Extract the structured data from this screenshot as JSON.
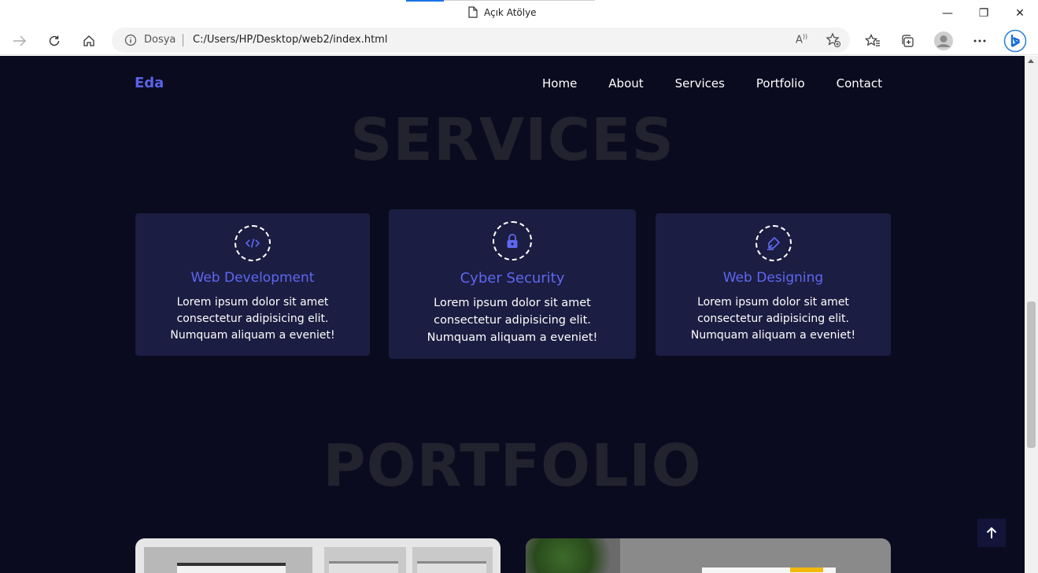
{
  "window": {
    "title": "Açık Atölye"
  },
  "addressbar": {
    "security_label": "Dosya",
    "url": "C:/Users/HP/Desktop/web2/index.html"
  },
  "site": {
    "logo": "Eda",
    "nav": [
      "Home",
      "About",
      "Services",
      "Portfolio",
      "Contact"
    ],
    "services_heading": "SERVICES",
    "services": [
      {
        "icon": "code-icon",
        "title": "Web Development",
        "text": "Lorem ipsum dolor sit amet consectetur adipisicing elit. Numquam aliquam a eveniet!"
      },
      {
        "icon": "lock-icon",
        "title": "Cyber Security",
        "text": "Lorem ipsum dolor sit amet consectetur adipisicing elit. Numquam aliquam a eveniet!"
      },
      {
        "icon": "pen-icon",
        "title": "Web Designing",
        "text": "Lorem ipsum dolor sit amet consectetur adipisicing elit. Numquam aliquam a eveniet!"
      }
    ],
    "portfolio_heading": "PORTFOLIO"
  },
  "colors": {
    "page_bg": "#0b0b1f",
    "card_bg": "#1c1d42",
    "accent": "#5b63e8"
  }
}
